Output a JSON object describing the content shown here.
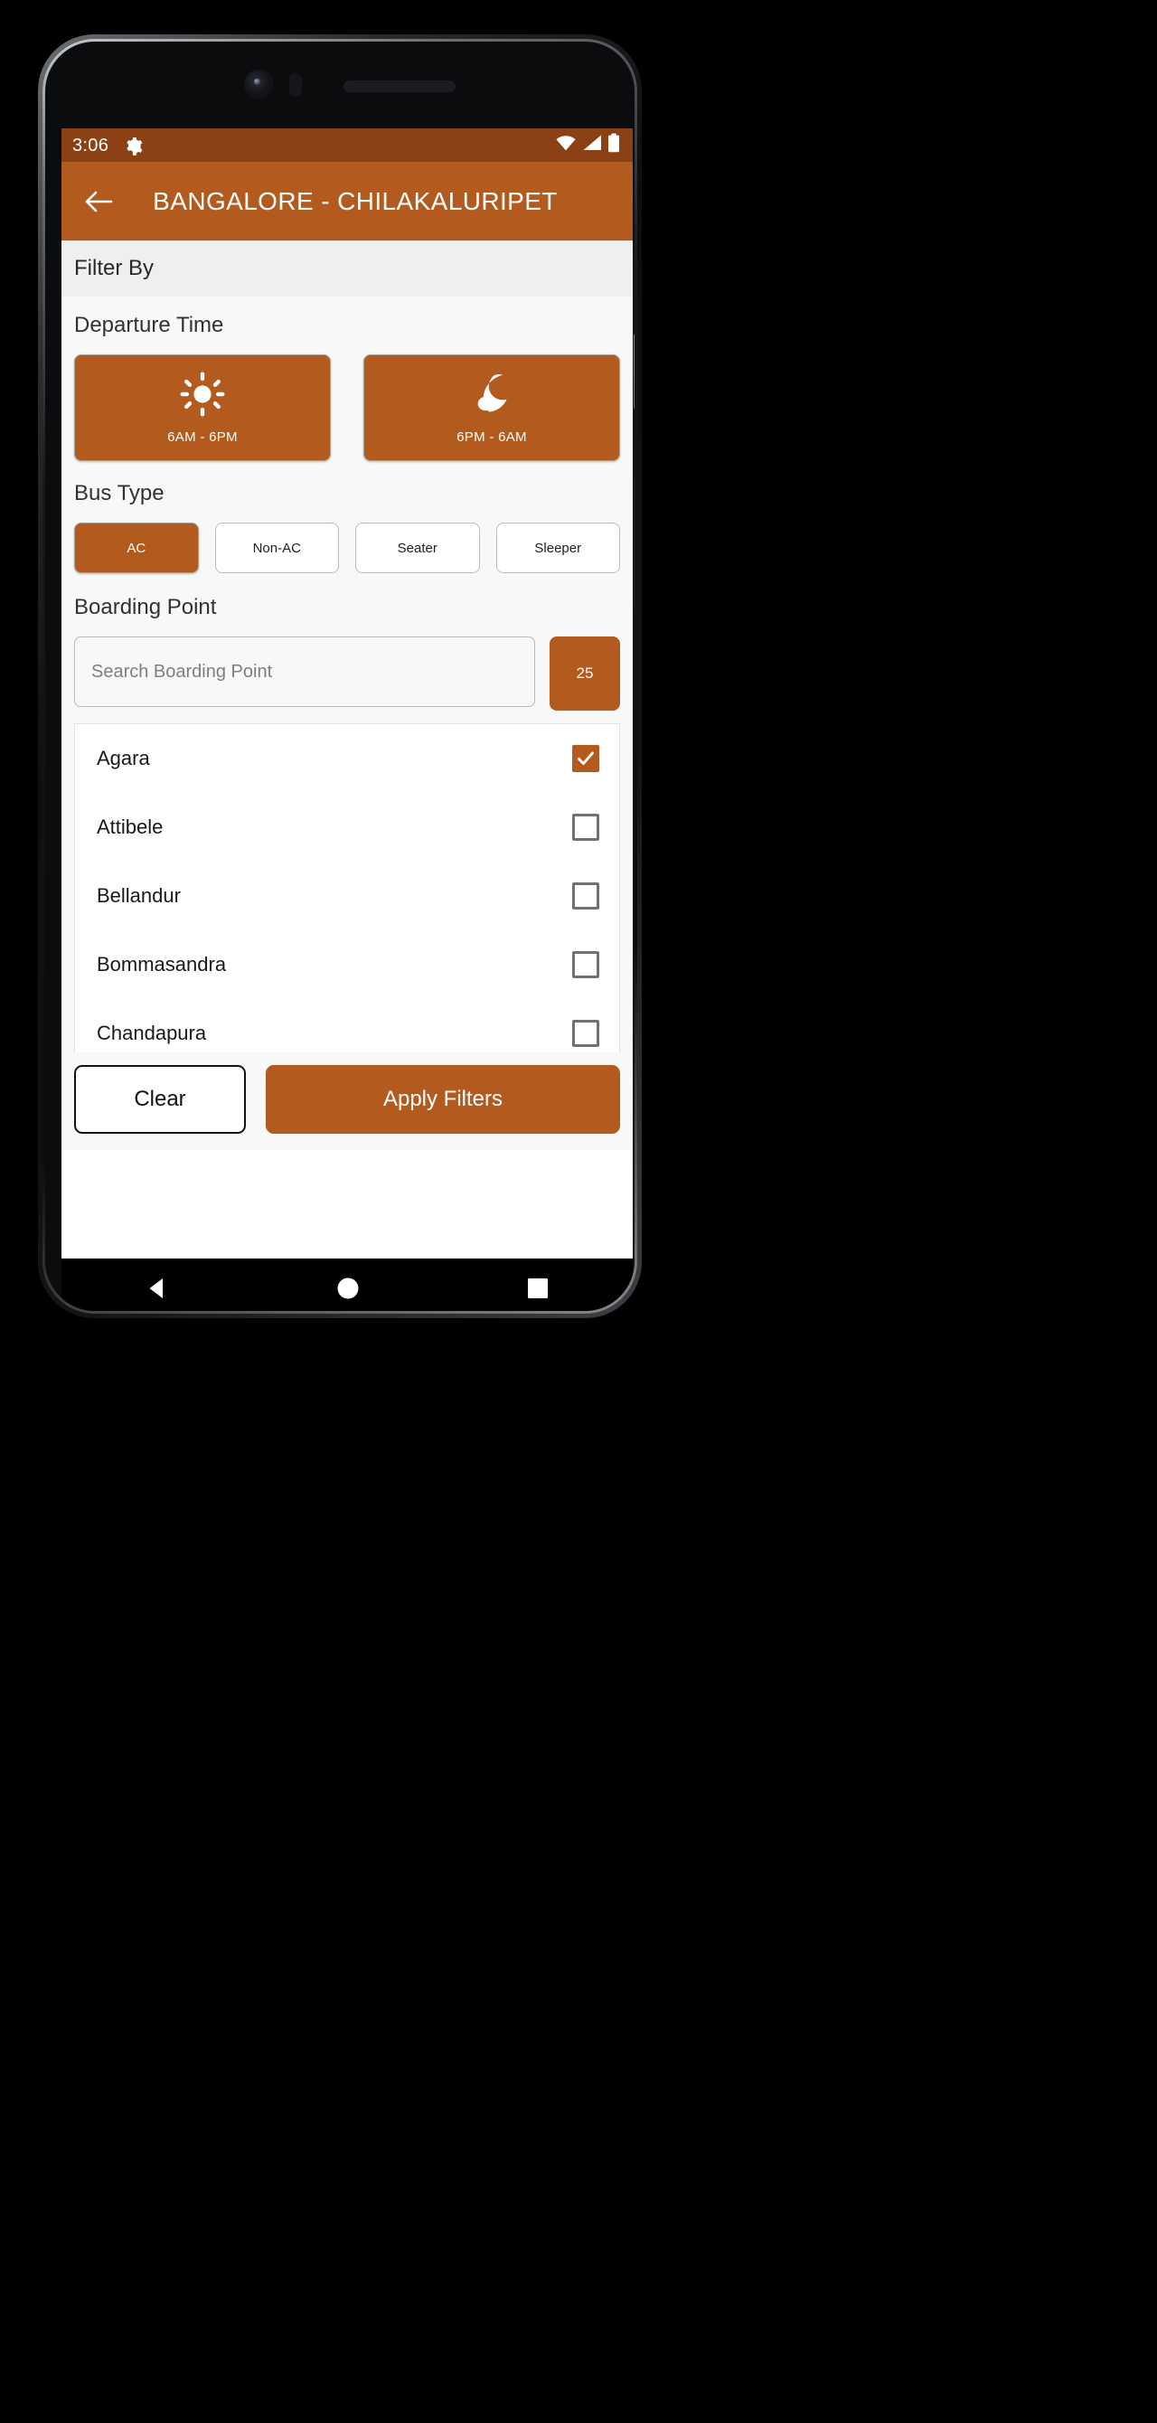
{
  "status_bar": {
    "time": "3:06",
    "gear_icon": "gear-icon",
    "wifi_icon": "wifi-icon",
    "signal_icon": "cell-signal-icon",
    "battery_icon": "battery-icon"
  },
  "app_bar": {
    "back_icon": "back-arrow-icon",
    "title": "BANGALORE - CHILAKALURIPET"
  },
  "filter_header": {
    "label": "Filter By"
  },
  "departure_time": {
    "label": "Departure Time",
    "options": [
      {
        "label": "6AM - 6PM",
        "icon": "sun-icon",
        "selected": true
      },
      {
        "label": "6PM - 6AM",
        "icon": "moon-icon",
        "selected": true
      }
    ]
  },
  "bus_type": {
    "label": "Bus Type",
    "options": [
      {
        "label": "AC",
        "selected": true
      },
      {
        "label": "Non-AC",
        "selected": false
      },
      {
        "label": "Seater",
        "selected": false
      },
      {
        "label": "Sleeper",
        "selected": false
      }
    ]
  },
  "boarding_point": {
    "label": "Boarding Point",
    "search_placeholder": "Search Boarding Point",
    "search_value": "",
    "count_badge": "25",
    "items": [
      {
        "name": "Agara",
        "checked": true
      },
      {
        "name": "Attibele",
        "checked": false
      },
      {
        "name": "Bellandur",
        "checked": false
      },
      {
        "name": "Bommasandra",
        "checked": false
      },
      {
        "name": "Chandapura",
        "checked": false
      }
    ]
  },
  "actions": {
    "clear_label": "Clear",
    "apply_label": "Apply Filters"
  },
  "nav_bar": {
    "back_icon": "nav-back-triangle-icon",
    "home_icon": "nav-home-circle-icon",
    "recents_icon": "nav-recents-square-icon"
  },
  "colors": {
    "accent": "#b35a1f",
    "status_bar": "#8c4114",
    "sheet_bg": "#f8f8f8",
    "filter_strip": "#efefef"
  }
}
